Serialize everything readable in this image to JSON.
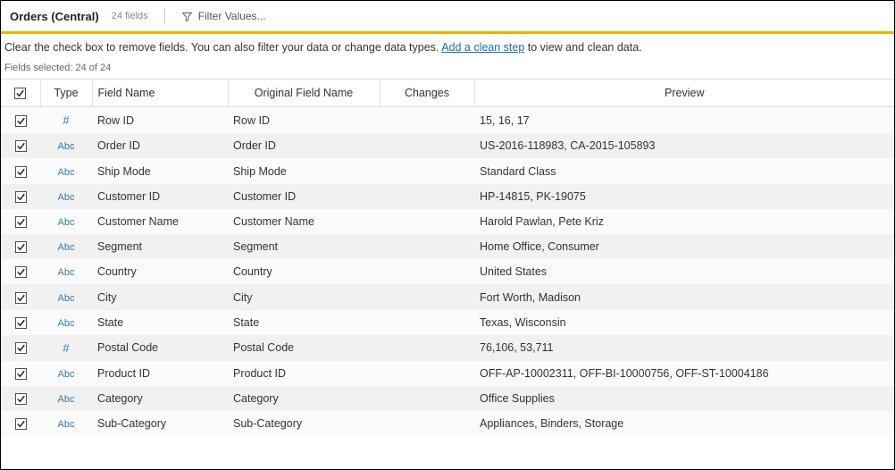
{
  "header": {
    "title": "Orders (Central)",
    "field_count_label": "24 fields",
    "filter_label": "Filter Values..."
  },
  "info": {
    "text_before": "Clear the check box to remove fields. You can also filter your data or change data types. ",
    "link_text": "Add a clean step",
    "text_after": " to view and clean data."
  },
  "fields_selected": "Fields selected: 24 of 24",
  "columns": {
    "chk": "",
    "type": "Type",
    "field_name": "Field Name",
    "original_field_name": "Original Field Name",
    "changes": "Changes",
    "preview": "Preview"
  },
  "type_glyphs": {
    "number": "#",
    "string": "Abc"
  },
  "rows": [
    {
      "checked": true,
      "type": "number",
      "field_name": "Row ID",
      "original": "Row ID",
      "changes": "",
      "preview": "15, 16, 17"
    },
    {
      "checked": true,
      "type": "string",
      "field_name": "Order ID",
      "original": "Order ID",
      "changes": "",
      "preview": "US-2016-118983, CA-2015-105893"
    },
    {
      "checked": true,
      "type": "string",
      "field_name": "Ship Mode",
      "original": "Ship Mode",
      "changes": "",
      "preview": "Standard Class"
    },
    {
      "checked": true,
      "type": "string",
      "field_name": "Customer ID",
      "original": "Customer ID",
      "changes": "",
      "preview": "HP-14815, PK-19075"
    },
    {
      "checked": true,
      "type": "string",
      "field_name": "Customer Name",
      "original": "Customer Name",
      "changes": "",
      "preview": "Harold Pawlan, Pete Kriz"
    },
    {
      "checked": true,
      "type": "string",
      "field_name": "Segment",
      "original": "Segment",
      "changes": "",
      "preview": "Home Office, Consumer"
    },
    {
      "checked": true,
      "type": "string",
      "field_name": "Country",
      "original": "Country",
      "changes": "",
      "preview": "United States"
    },
    {
      "checked": true,
      "type": "string",
      "field_name": "City",
      "original": "City",
      "changes": "",
      "preview": "Fort Worth, Madison"
    },
    {
      "checked": true,
      "type": "string",
      "field_name": "State",
      "original": "State",
      "changes": "",
      "preview": "Texas, Wisconsin"
    },
    {
      "checked": true,
      "type": "number",
      "field_name": "Postal Code",
      "original": "Postal Code",
      "changes": "",
      "preview": "76,106, 53,711"
    },
    {
      "checked": true,
      "type": "string",
      "field_name": "Product ID",
      "original": "Product ID",
      "changes": "",
      "preview": "OFF-AP-10002311, OFF-BI-10000756, OFF-ST-10004186"
    },
    {
      "checked": true,
      "type": "string",
      "field_name": "Category",
      "original": "Category",
      "changes": "",
      "preview": "Office Supplies"
    },
    {
      "checked": true,
      "type": "string",
      "field_name": "Sub-Category",
      "original": "Sub-Category",
      "changes": "",
      "preview": "Appliances, Binders, Storage"
    }
  ]
}
